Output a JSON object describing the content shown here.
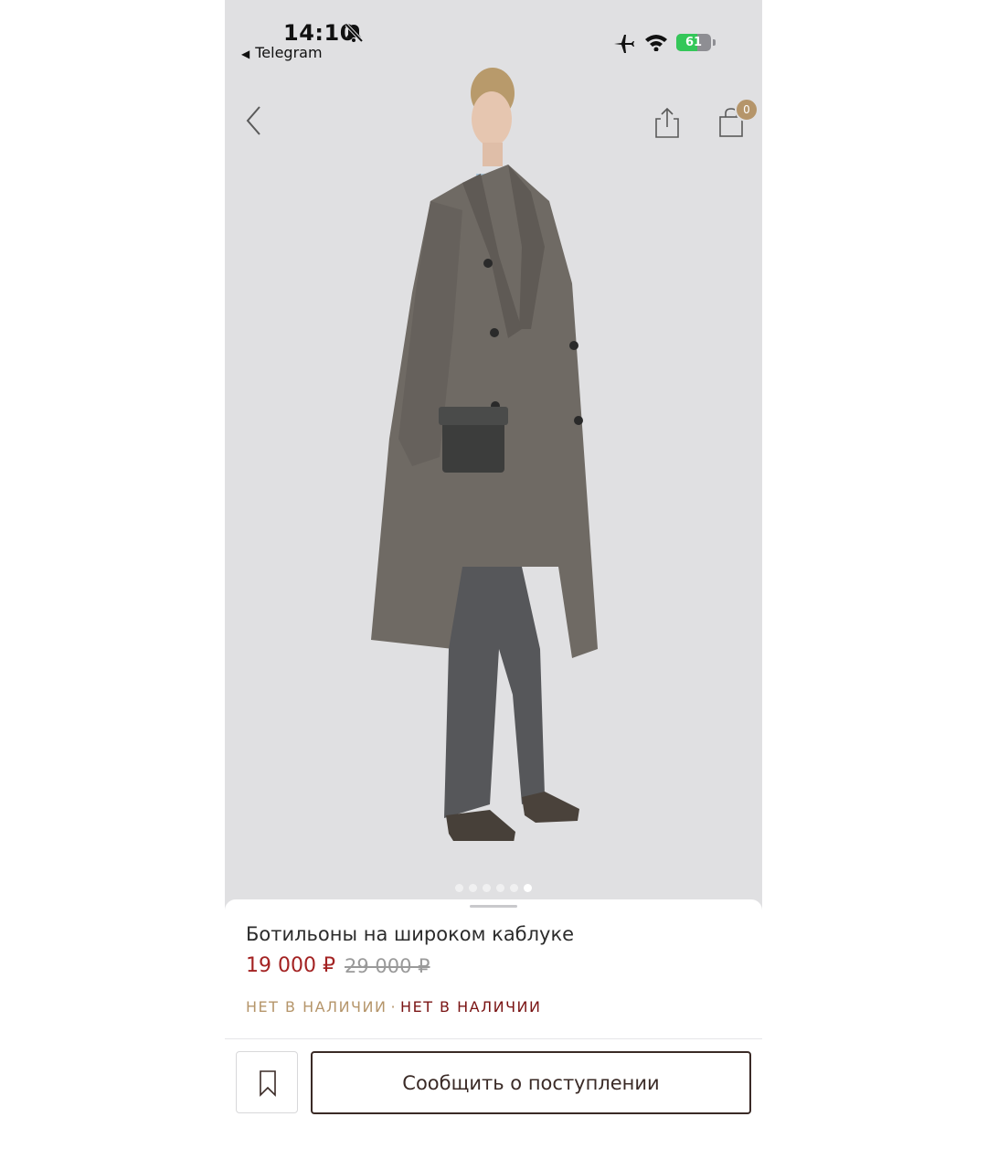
{
  "status_bar": {
    "time": "14:10",
    "back_app": "Telegram",
    "battery": "61",
    "battery_level": 0.61,
    "icons": [
      "bell-slash-icon",
      "airplane-icon",
      "wifi-icon",
      "battery-icon"
    ]
  },
  "nav": {
    "icons": [
      "chevron-left-icon",
      "share-icon",
      "shopping-bag-icon"
    ],
    "cart_count": "0"
  },
  "gallery": {
    "total": 6,
    "active": 6
  },
  "product": {
    "title": "Ботильоны на широком каблуке",
    "price": "19 000 ₽",
    "old_price": "29 000 ₽",
    "availability_1": "НЕТ В НАЛИЧИИ",
    "availability_sep": "·",
    "availability_2": "НЕТ В НАЛИЧИИ"
  },
  "actions": {
    "bookmark_icon": "bookmark-icon",
    "notify_label": "Сообщить о поступлении"
  },
  "colors": {
    "accent_gold": "#b5956a",
    "price_red": "#a32222",
    "dark_red": "#7a1414",
    "button_border": "#3a2a26"
  }
}
